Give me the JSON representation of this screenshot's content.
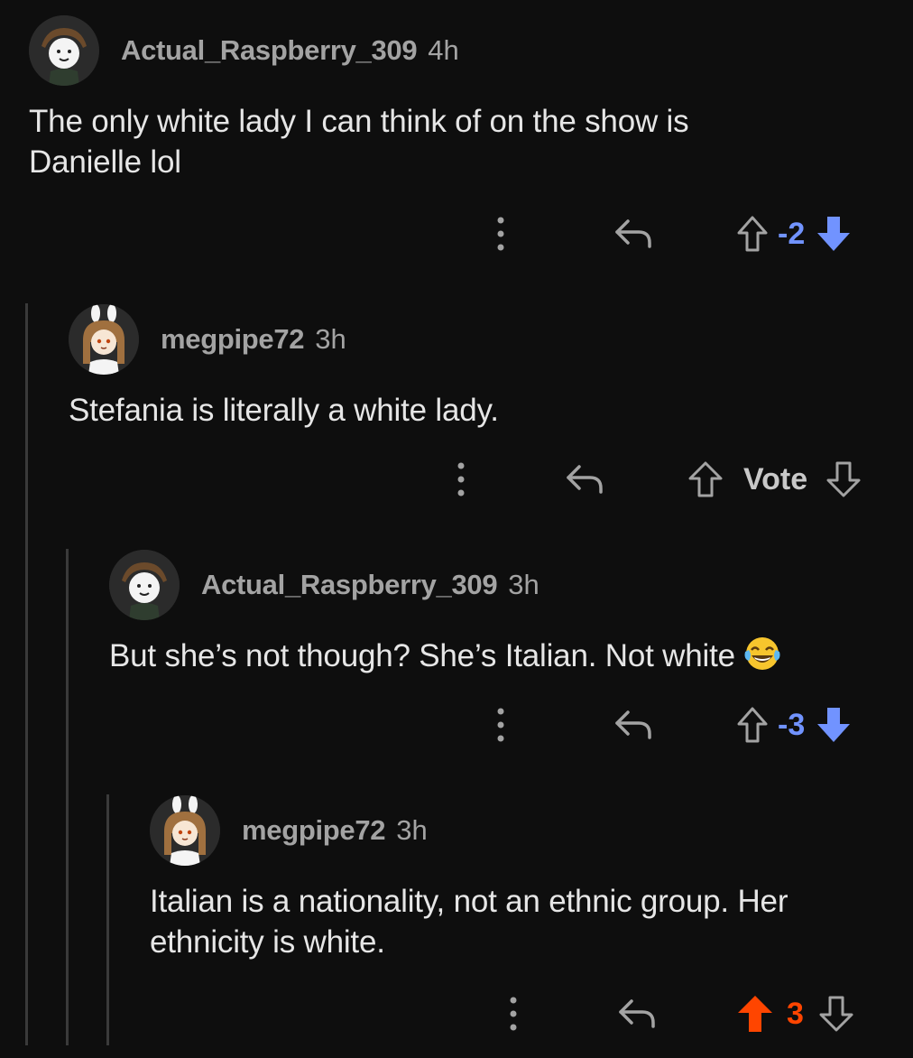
{
  "comments": [
    {
      "author": "Actual_Raspberry_309",
      "time": "4h",
      "text_lines": [
        "The only white lady I can think of on the show is",
        "Danielle lol"
      ],
      "score": "-2",
      "vote_state": "downvoted"
    },
    {
      "author": "megpipe72",
      "time": "3h",
      "text_lines": [
        "Stefania is literally a white lady."
      ],
      "score": "Vote",
      "vote_state": "none"
    },
    {
      "author": "Actual_Raspberry_309",
      "time": "3h",
      "text_lines": [
        "But she’s not though? She’s Italian. Not white"
      ],
      "emoji": "face-with-tears-of-joy",
      "score": "-3",
      "vote_state": "downvoted"
    },
    {
      "author": "megpipe72",
      "time": "3h",
      "text_lines": [
        "Italian is a nationality, not an ethnic group. Her",
        "ethnicity is white."
      ],
      "score": "3",
      "vote_state": "upvoted"
    }
  ],
  "colors": {
    "background": "#0e0e0e",
    "upvote": "#ff4500",
    "downvote": "#7193ff",
    "muted": "#a3a3a3"
  },
  "icons": [
    "more-options-icon",
    "reply-icon",
    "upvote-icon",
    "downvote-icon"
  ]
}
